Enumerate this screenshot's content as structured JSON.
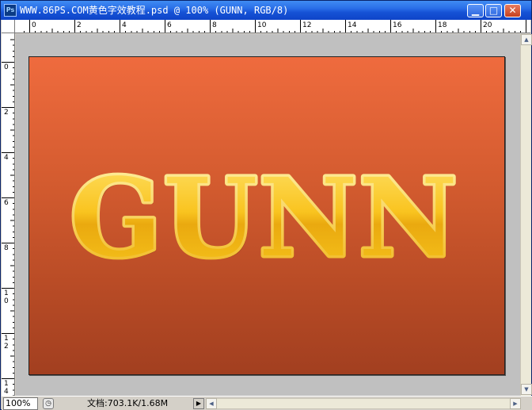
{
  "window": {
    "title": "WWW.86PS.COM黄色字效教程.psd @ 100% (GUNN, RGB/8)",
    "app_icon": "Ps",
    "controls": {
      "minimize": "▁",
      "maximize": "□",
      "close": "✕"
    }
  },
  "rulers": {
    "horizontal_labels": [
      "0",
      "2",
      "4",
      "6",
      "8",
      "10",
      "12",
      "14",
      "16",
      "18",
      "20"
    ],
    "vertical_labels": [
      "0",
      "2",
      "4",
      "6",
      "8",
      "1 0",
      "1 2",
      "1 4"
    ]
  },
  "canvas": {
    "text": "GUNN",
    "background_top": "#ef6b3e",
    "background_bottom": "#a23f20",
    "text_color": "#f7c21a"
  },
  "statusbar": {
    "zoom": "100%",
    "doc_info": "文档:703.1K/1.68M",
    "status_icon": "◷",
    "menu_arrow": "▶"
  },
  "scrollbars": {
    "up": "▲",
    "down": "▼",
    "left": "◀",
    "right": "▶"
  }
}
